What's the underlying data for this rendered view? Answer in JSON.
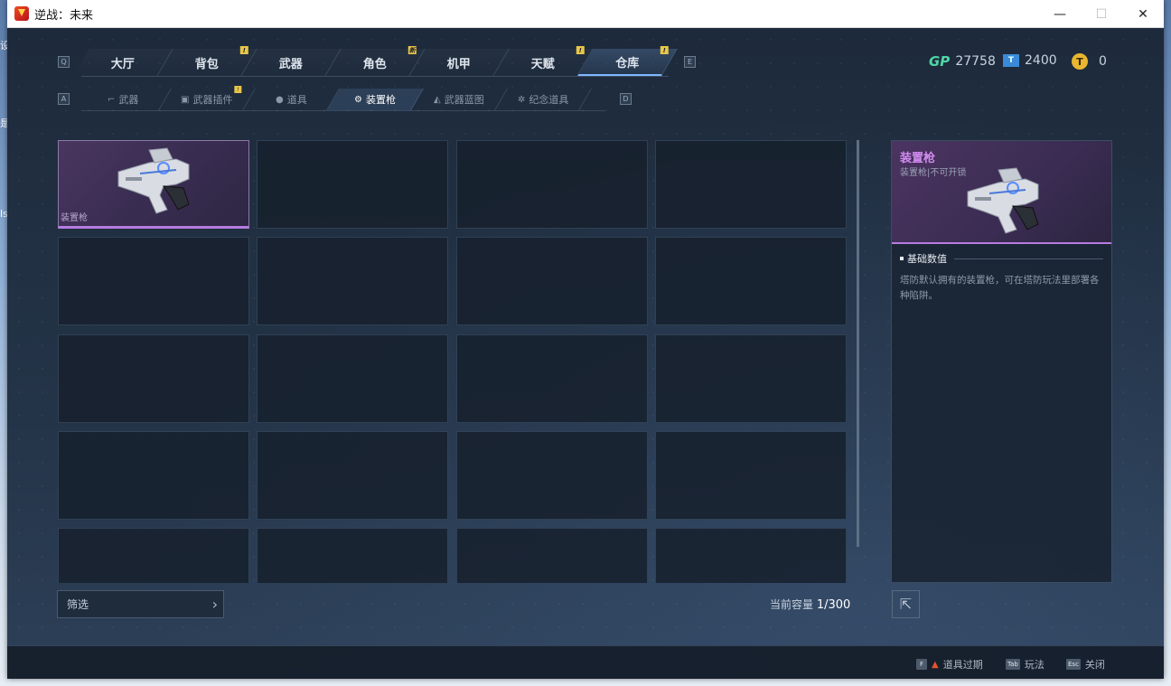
{
  "window": {
    "title": "逆战：未来",
    "controls": {
      "minimize": "—",
      "maximize": "☐",
      "close": "✕"
    }
  },
  "nav": {
    "left_key": "Q",
    "right_key": "E",
    "tabs": [
      {
        "label": "大厅",
        "badge": ""
      },
      {
        "label": "背包",
        "badge": "!"
      },
      {
        "label": "武器",
        "badge": ""
      },
      {
        "label": "角色",
        "badge": "新"
      },
      {
        "label": "机甲",
        "badge": ""
      },
      {
        "label": "天赋",
        "badge": "!"
      },
      {
        "label": "仓库",
        "badge": "!",
        "active": true
      }
    ]
  },
  "subnav": {
    "left_key": "A",
    "right_key": "D",
    "tabs": [
      {
        "label": "武器",
        "icon": "rifle-icon",
        "badge": ""
      },
      {
        "label": "武器插件",
        "icon": "chip-icon",
        "badge": "!"
      },
      {
        "label": "道具",
        "icon": "grenade-icon",
        "badge": ""
      },
      {
        "label": "装置枪",
        "icon": "device-gun-icon",
        "badge": "",
        "active": true
      },
      {
        "label": "武器蓝图",
        "icon": "blueprint-icon",
        "badge": ""
      },
      {
        "label": "纪念道具",
        "icon": "medal-icon",
        "badge": ""
      }
    ]
  },
  "currency": {
    "gp_label": "GP",
    "gp_value": "27758",
    "ticket_label": "T",
    "ticket_value": "2400",
    "coin_label": "T",
    "coin_value": "0"
  },
  "inventory": {
    "items": [
      {
        "label": "装置枪",
        "rarity_color": "#b77be0"
      }
    ],
    "filter_label": "筛选",
    "capacity_label": "当前容量",
    "capacity_value": "1/300"
  },
  "detail": {
    "name": "装置枪",
    "subtitle": "装置枪|不可开锁",
    "section_title": "基础数值",
    "description": "塔防默认拥有的装置枪，可在塔防玩法里部署各种陷阱。"
  },
  "footer": {
    "hints": [
      {
        "key": "F",
        "label": "道具过期",
        "warning": true
      },
      {
        "key": "Tab",
        "label": "玩法"
      },
      {
        "key": "Esc",
        "label": "关闭"
      }
    ]
  },
  "colors": {
    "accent": "#7fb7ff",
    "rarity_purple": "#b77be0",
    "gp_green": "#4fd6a6",
    "badge_yellow": "#e8c64a"
  }
}
